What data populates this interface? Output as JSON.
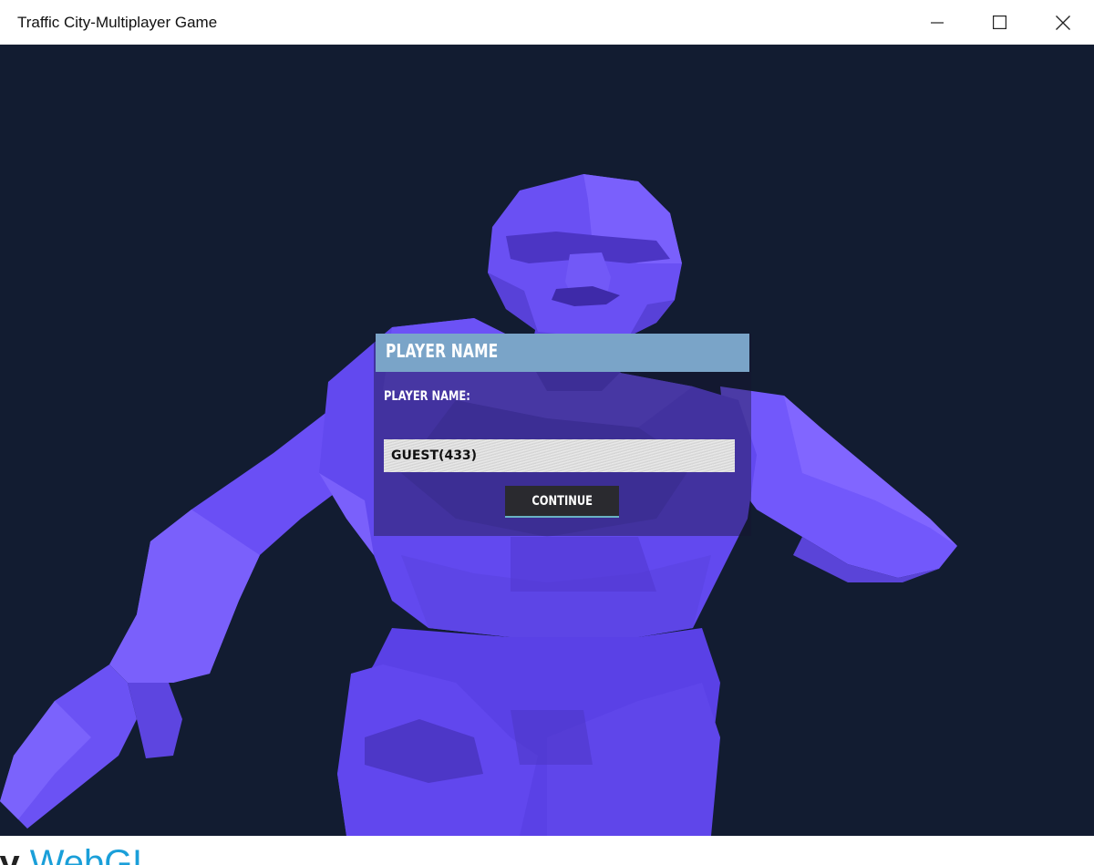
{
  "window": {
    "title": "Traffic City-Multiplayer Game"
  },
  "dialog": {
    "title": "PLAYER NAME",
    "label": "PLAYER NAME:",
    "input_value": "GUEST(433)",
    "continue_label": "CONTINUE"
  },
  "footer": {
    "logo_part1": "ty",
    "logo_part2": " WebGL"
  },
  "colors": {
    "canvas_bg": "#121c31",
    "dialog_header": "#7aa4c8",
    "button_bg": "#2a2a2f",
    "button_underline": "#69b2c4",
    "character": "#6a4ff0"
  },
  "icons": {
    "minimize": "minimize-icon",
    "maximize": "maximize-icon",
    "close": "close-icon"
  }
}
